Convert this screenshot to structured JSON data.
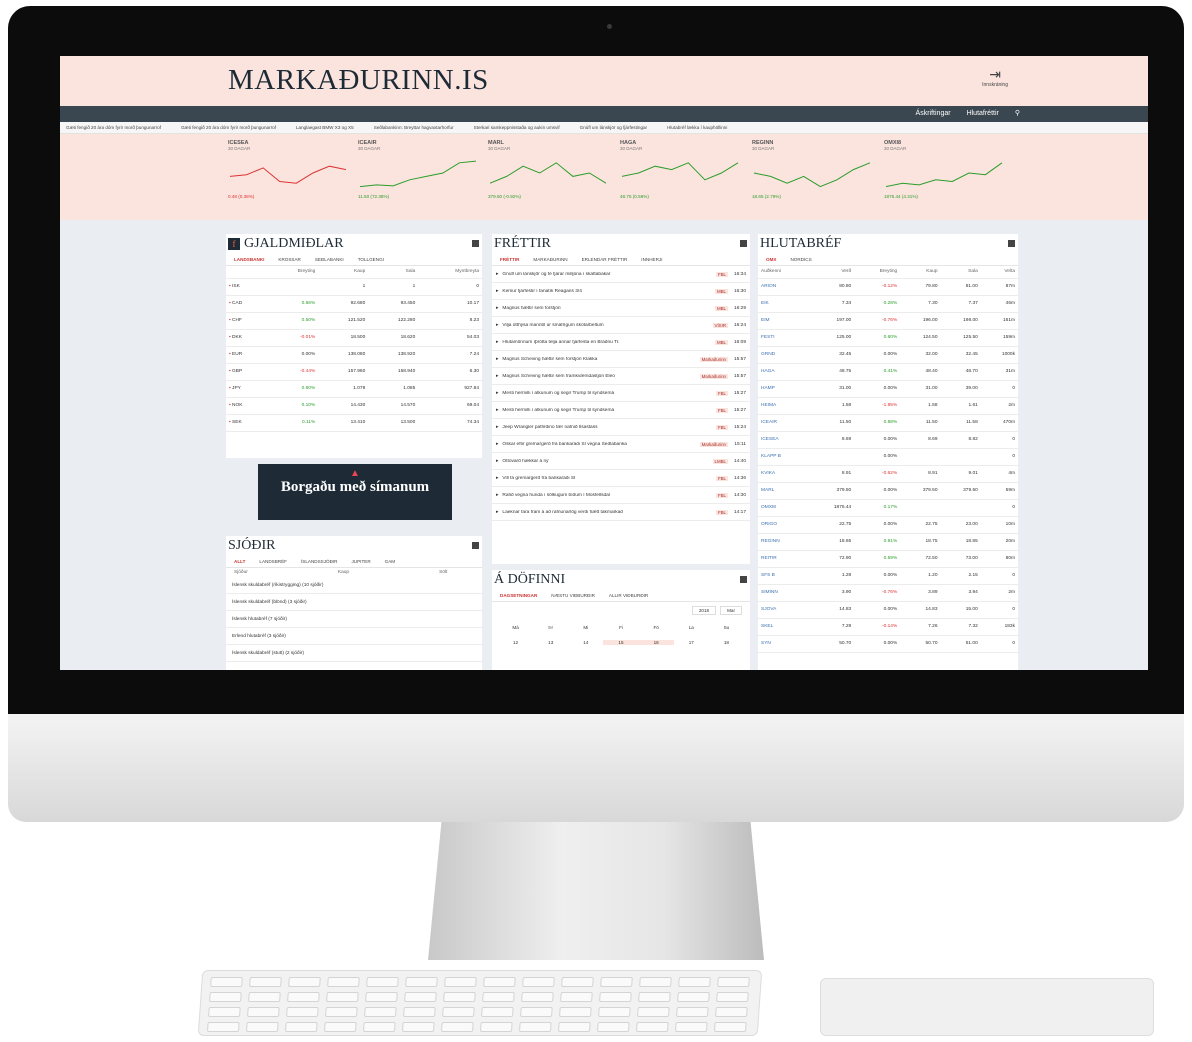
{
  "site": {
    "logo": "MARKAÐURINN.IS",
    "login_label": "Innskráning",
    "nav_links": [
      "Áskriftingar",
      "Hlutafréttir"
    ],
    "ticker": [
      "Gæti fengið 20 ára dóm fyrir morð þungunarrof",
      "Gæti fengið 20 ára dóm fyrir morð þungunarrof",
      "Langlaegast BMW X3 og X5",
      "Seðlabankinn: Breyttar hagvaxtarhorfur",
      "Sterkari samkeppnisstaða og aukin umsvif",
      "Gnúfl um lánskjör og fjárfestingar",
      "Hlutabréf lækka í kauphöllinni"
    ]
  },
  "sparklines": [
    {
      "name": "ICESEA",
      "sub": "30 DAGAR",
      "value": "0.48 (0.38%)",
      "color": "#d33",
      "trend": [
        0.6,
        0.55,
        0.35,
        0.75,
        0.8,
        0.5,
        0.3,
        0.4
      ]
    },
    {
      "name": "ICEAIR",
      "sub": "30 DAGAR",
      "value": "11.50 (72.38%)",
      "color": "#2a9d2a",
      "trend": [
        0.9,
        0.85,
        0.88,
        0.7,
        0.6,
        0.5,
        0.2,
        0.15
      ]
    },
    {
      "name": "MARL",
      "sub": "30 DAGAR",
      "value": "379.50 (-0.92%)",
      "color": "#2a9d2a",
      "trend": [
        0.8,
        0.6,
        0.3,
        0.5,
        0.2,
        0.6,
        0.5,
        0.8
      ]
    },
    {
      "name": "HAGA",
      "sub": "30 DAGAR",
      "value": "48.75 (0.58%)",
      "color": "#2a9d2a",
      "trend": [
        0.6,
        0.5,
        0.3,
        0.4,
        0.2,
        0.7,
        0.5,
        0.2
      ]
    },
    {
      "name": "REGINN",
      "sub": "30 DAGAR",
      "value": "18.65 (2.79%)",
      "color": "#2a9d2a",
      "trend": [
        0.5,
        0.6,
        0.8,
        0.6,
        0.9,
        0.7,
        0.4,
        0.2
      ]
    },
    {
      "name": "OMXI8",
      "sub": "30 DAGAR",
      "value": "1875.44 (4.31%)",
      "color": "#2a9d2a",
      "trend": [
        0.9,
        0.8,
        0.85,
        0.7,
        0.75,
        0.5,
        0.55,
        0.2
      ]
    }
  ],
  "gjaldmidlar": {
    "title": "GJALDMIÐLAR",
    "tabs": [
      "LANDSBANKI",
      "KROSSAR",
      "SEÐLABANKI",
      "TOLLGENGI"
    ],
    "headers": [
      "",
      "Breyting",
      "Kaup",
      "Sala",
      "Myntbreyta"
    ],
    "rows": [
      {
        "code": "ISK",
        "change": "",
        "buy": "1",
        "sell": "1",
        "conv": "0"
      },
      {
        "code": "CAD",
        "change": "0.66%",
        "buy": "92.680",
        "sell": "93.450",
        "conv": "10.17",
        "dir": "up"
      },
      {
        "code": "CHF",
        "change": "0.50%",
        "buy": "121.520",
        "sell": "122.280",
        "conv": "8.23",
        "dir": "up"
      },
      {
        "code": "DKK",
        "change": "-0.01%",
        "buy": "18.500",
        "sell": "18.620",
        "conv": "54.03",
        "dir": "down"
      },
      {
        "code": "EUR",
        "change": "0.00%",
        "buy": "138.080",
        "sell": "138.920",
        "conv": "7.24",
        "dir": "flat"
      },
      {
        "code": "GBP",
        "change": "-0.44%",
        "buy": "157.960",
        "sell": "158.940",
        "conv": "6.30",
        "dir": "down"
      },
      {
        "code": "JPY",
        "change": "0.60%",
        "buy": "1.078",
        "sell": "1.085",
        "conv": "927.84",
        "dir": "up"
      },
      {
        "code": "NOK",
        "change": "0.10%",
        "buy": "14.430",
        "sell": "14.570",
        "conv": "69.04",
        "dir": "up"
      },
      {
        "code": "SEK",
        "change": "0.11%",
        "buy": "13.410",
        "sell": "13.500",
        "conv": "74.34",
        "dir": "up"
      }
    ]
  },
  "ad": {
    "text": "Borgaðu með símanum"
  },
  "sjodir": {
    "title": "SJÓÐIR",
    "tabs": [
      "ALLT",
      "LANDSBRÉF",
      "ÍSLANDSSJÓÐIR",
      "JUPITER",
      "GAM"
    ],
    "headers": [
      "Sjóður",
      "Kaup",
      "Sölt",
      "Saga"
    ],
    "items": [
      "Íslensk skuldabréf (ríkistrygging) (10 sjóðir)",
      "Íslensk skuldabréf (blönd) (3 sjóðir)",
      "Íslensk hlutabréf (7 sjóðir)",
      "Erlend hlutabréf (3 sjóðir)",
      "Íslensk skuldabréf (stutt) (2 sjóðir)"
    ]
  },
  "frettir": {
    "title": "FRÉTTIR",
    "tabs": [
      "FRÉTTIR",
      "MARKAÐURINN",
      "ERLENDAR FRÉTTIR",
      "INNHERJI"
    ],
    "items": [
      {
        "text": "Gnúfl um lánskjör og fé fjárar milljóna í skattabakar",
        "src": "FBL",
        "time": "16:34"
      },
      {
        "text": "Kemur fjárfestir í fanatík Reagans 3/4",
        "src": "MBL",
        "time": "16:30"
      },
      {
        "text": "Magnús hættir sem forstjóri",
        "src": "MBL",
        "time": "16:29"
      },
      {
        "text": "Vilja ótthýsa manntíl úr smáfrígum skótarbeltum",
        "src": "VÍSIR",
        "time": "16:24"
      },
      {
        "text": "Hlutamönnum íþrótta telja annar fjárfesta en Bráðnu Tr.",
        "src": "MBL",
        "time": "16:09"
      },
      {
        "text": "Magnús Scheving hættir sem forstjóri Klakka",
        "src": "Markaðurinn",
        "time": "15:57"
      },
      {
        "text": "Magnús Scheving hættir sem framkvæmdastjóri Eleó",
        "src": "Markaðurinn",
        "time": "15:57"
      },
      {
        "text": "Mesti hermilli í atkunum og segir Trump til syndsemá",
        "src": "FBL",
        "time": "15:27"
      },
      {
        "text": "Mesti hermilli í atkunum og segir Trump til syndsemá",
        "src": "FBL",
        "time": "15:27"
      },
      {
        "text": "Jeep Wrangler patfirðino fær nafnið Ilsastáss",
        "src": "FBL",
        "time": "15:24"
      },
      {
        "text": "Óskar eftir gremargerð frá bankaráði SÍ vegna Seðlabanka",
        "src": "Markaðurinn",
        "time": "15:11"
      },
      {
        "text": "Óttóvarð hækkar á ný",
        "src": "LMBL",
        "time": "14:40"
      },
      {
        "text": "Vill fá gremargerð frá bankaráði SÍ",
        "src": "FBL",
        "time": "14:36"
      },
      {
        "text": "Rafið vegna hunda í sölkugum bíðum í Mosfellsdal",
        "src": "FBL",
        "time": "14:30"
      },
      {
        "text": "Laeknar fara fram á að rafnunarlög verði hætt takmarkað",
        "src": "FBL",
        "time": "14:17"
      }
    ]
  },
  "adofinni": {
    "title": "Á DÖFINNI",
    "tabs": [
      "DAGSETNINGAR",
      "NÆSTU VIÐBURÐIR",
      "ALLIR VIÐBURÐIR"
    ],
    "year": "2018",
    "month": "Mar",
    "weekdays": [
      "Má",
      "Þr",
      "Mi",
      "Fi",
      "Fö",
      "La",
      "Su"
    ],
    "days": [
      "12",
      "13",
      "14",
      "15",
      "16",
      "17",
      "18"
    ]
  },
  "hlutabref": {
    "title": "HLUTABRÉF",
    "tabs": [
      "OMX",
      "NORDICS"
    ],
    "headers": [
      "Auðkenni",
      "Verð",
      "Breyting",
      "Kaup",
      "Sala",
      "Velta"
    ],
    "rows": [
      {
        "sym": "ARION",
        "price": "80.80",
        "chg": "-0.12%",
        "buy": "79.80",
        "sell": "81.00",
        "vol": "87m",
        "dir": "down"
      },
      {
        "sym": "EIK",
        "price": "7.34",
        "chg": "0.28%",
        "buy": "7.30",
        "sell": "7.37",
        "vol": "46m",
        "dir": "up"
      },
      {
        "sym": "EIM",
        "price": "197.00",
        "chg": "-0.76%",
        "buy": "196.00",
        "sell": "198.00",
        "vol": "161m",
        "dir": "down"
      },
      {
        "sym": "FESTI",
        "price": "125.00",
        "chg": "0.60%",
        "buy": "124.50",
        "sell": "125.50",
        "vol": "159m",
        "dir": "up"
      },
      {
        "sym": "GRND",
        "price": "32.45",
        "chg": "0.00%",
        "buy": "32.00",
        "sell": "32.45",
        "vol": "1000k",
        "dir": "flat"
      },
      {
        "sym": "HAGA",
        "price": "48.75",
        "chg": "0.41%",
        "buy": "48.40",
        "sell": "48.70",
        "vol": "31m",
        "dir": "up"
      },
      {
        "sym": "HAMP",
        "price": "31.00",
        "chg": "0.00%",
        "buy": "31.00",
        "sell": "39.00",
        "vol": "0",
        "dir": "flat"
      },
      {
        "sym": "HEIMA",
        "price": "1.58",
        "chg": "-1.85%",
        "buy": "1.58",
        "sell": "1.61",
        "vol": "2m",
        "dir": "down"
      },
      {
        "sym": "ICEAIR",
        "price": "11.50",
        "chg": "0.88%",
        "buy": "11.50",
        "sell": "11.58",
        "vol": "470m",
        "dir": "up"
      },
      {
        "sym": "ICESEA",
        "price": "8.69",
        "chg": "0.00%",
        "buy": "8.69",
        "sell": "8.82",
        "vol": "0",
        "dir": "flat"
      },
      {
        "sym": "KLAPP B",
        "price": "",
        "chg": "0.00%",
        "buy": "",
        "sell": "",
        "vol": "0",
        "dir": "flat"
      },
      {
        "sym": "KVIKA",
        "price": "8.91",
        "chg": "-0.62%",
        "buy": "8.91",
        "sell": "9.01",
        "vol": "4m",
        "dir": "down"
      },
      {
        "sym": "MARL",
        "price": "379.50",
        "chg": "0.00%",
        "buy": "379.50",
        "sell": "379.50",
        "vol": "59m",
        "dir": "flat"
      },
      {
        "sym": "OMXI8",
        "price": "1875.44",
        "chg": "0.17%",
        "buy": "",
        "sell": "",
        "vol": "0",
        "dir": "up"
      },
      {
        "sym": "ORIGO",
        "price": "22.75",
        "chg": "0.00%",
        "buy": "22.75",
        "sell": "23.00",
        "vol": "10m",
        "dir": "flat"
      },
      {
        "sym": "REGINN",
        "price": "18.65",
        "chg": "0.91%",
        "buy": "18.75",
        "sell": "18.85",
        "vol": "20m",
        "dir": "up"
      },
      {
        "sym": "REITIR",
        "price": "72.90",
        "chg": "0.59%",
        "buy": "72.50",
        "sell": "73.00",
        "vol": "80m",
        "dir": "up"
      },
      {
        "sym": "SFS B",
        "price": "1.28",
        "chg": "0.00%",
        "buy": "1.20",
        "sell": "2.15",
        "vol": "0",
        "dir": "flat"
      },
      {
        "sym": "SIMINN",
        "price": "3.90",
        "chg": "-0.76%",
        "buy": "3.89",
        "sell": "3.94",
        "vol": "2m",
        "dir": "down"
      },
      {
        "sym": "SJOVA",
        "price": "14.83",
        "chg": "0.00%",
        "buy": "14.83",
        "sell": "15.00",
        "vol": "0",
        "dir": "flat"
      },
      {
        "sym": "SKEL",
        "price": "7.29",
        "chg": "-0.14%",
        "buy": "7.26",
        "sell": "7.32",
        "vol": "183k",
        "dir": "down"
      },
      {
        "sym": "SYN",
        "price": "50.70",
        "chg": "0.00%",
        "buy": "50.70",
        "sell": "51.00",
        "vol": "0",
        "dir": "flat"
      }
    ]
  }
}
